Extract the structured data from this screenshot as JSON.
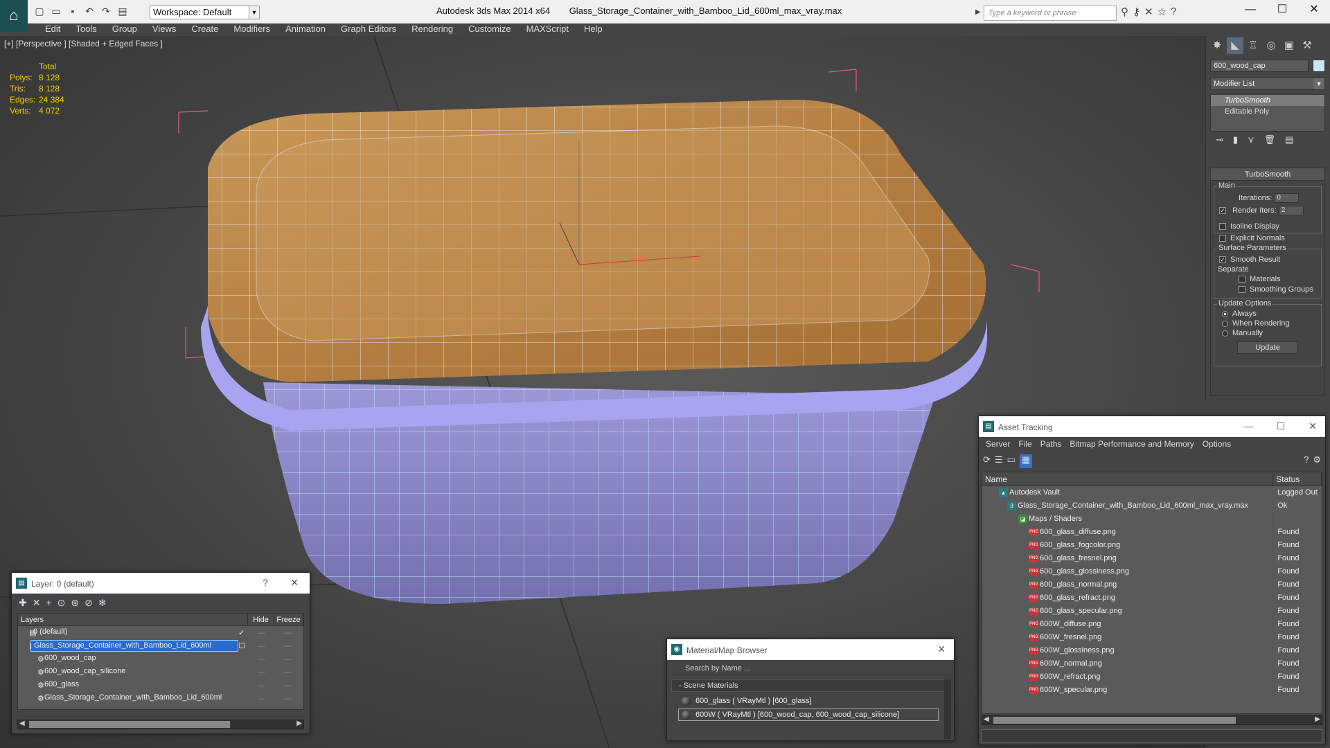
{
  "app": {
    "name": "Autodesk 3ds Max  2014 x64",
    "file": "Glass_Storage_Container_with_Bamboo_Lid_600ml_max_vray.max",
    "workspace": "Workspace: Default",
    "search_placeholder": "Type a keyword or phrase"
  },
  "menu": [
    "Edit",
    "Tools",
    "Group",
    "Views",
    "Create",
    "Modifiers",
    "Animation",
    "Graph Editors",
    "Rendering",
    "Customize",
    "MAXScript",
    "Help"
  ],
  "viewport": {
    "label": "[+] [Perspective ] [Shaded + Edged Faces ]",
    "stats_header": "Total",
    "stats": [
      {
        "k": "Polys:",
        "v": "8 128"
      },
      {
        "k": "Tris:",
        "v": "8 128"
      },
      {
        "k": "Edges:",
        "v": "24 384"
      },
      {
        "k": "Verts:",
        "v": "4 072"
      }
    ]
  },
  "command_panel": {
    "object_name": "600_wood_cap",
    "modifier_list": "Modifier List",
    "stack": [
      "TurboSmooth",
      "Editable Poly"
    ],
    "rollout_title": "TurboSmooth",
    "main_label": "Main",
    "iterations_label": "Iterations:",
    "iterations_value": "0",
    "render_iters_label": "Render Iters:",
    "render_iters_value": "2",
    "isoline": "Isoline Display",
    "explicit_normals": "Explicit Normals",
    "surface_label": "Surface Parameters",
    "smooth_result": "Smooth Result",
    "separate_label": "Separate",
    "materials": "Materials",
    "smoothing_groups": "Smoothing Groups",
    "update_label": "Update Options",
    "always": "Always",
    "when_rendering": "When Rendering",
    "manually": "Manually",
    "update_button": "Update"
  },
  "layers": {
    "title": "Layer: 0 (default)",
    "help": "?",
    "close": "✕",
    "col_layers": "Layers",
    "col_hide": "Hide",
    "col_freeze": "Freeze",
    "rows": [
      {
        "name": "0 (default)"
      },
      {
        "name": "Glass_Storage_Container_with_Bamboo_Lid_600ml"
      },
      {
        "name": "600_wood_cap"
      },
      {
        "name": "600_wood_cap_silicone"
      },
      {
        "name": "600_glass"
      },
      {
        "name": "Glass_Storage_Container_with_Bamboo_Lid_600ml"
      }
    ]
  },
  "material_browser": {
    "title": "Material/Map Browser",
    "search": "Search by Name ...",
    "section": "- Scene Materials",
    "rows": [
      "600_glass  ( VRayMtl )  [600_glass]",
      "600W  ( VRayMtl )  [600_wood_cap, 600_wood_cap_silicone]"
    ]
  },
  "asset_tracking": {
    "title": "Asset Tracking",
    "menu": [
      "Server",
      "File",
      "Paths",
      "Bitmap Performance and Memory",
      "Options"
    ],
    "col_name": "Name",
    "col_status": "Status",
    "rows": [
      {
        "name": "Autodesk Vault",
        "status": "Logged Out"
      },
      {
        "name": "Glass_Storage_Container_with_Bamboo_Lid_600ml_max_vray.max",
        "status": "Ok"
      },
      {
        "name": "Maps / Shaders",
        "status": ""
      },
      {
        "name": "600_glass_diffuse.png",
        "status": "Found"
      },
      {
        "name": "600_glass_fogcolor.png",
        "status": "Found"
      },
      {
        "name": "600_glass_fresnel.png",
        "status": "Found"
      },
      {
        "name": "600_glass_glossiness.png",
        "status": "Found"
      },
      {
        "name": "600_glass_normal.png",
        "status": "Found"
      },
      {
        "name": "600_glass_refract.png",
        "status": "Found"
      },
      {
        "name": "600_glass_specular.png",
        "status": "Found"
      },
      {
        "name": "600W_diffuse.png",
        "status": "Found"
      },
      {
        "name": "600W_fresnel.png",
        "status": "Found"
      },
      {
        "name": "600W_glossiness.png",
        "status": "Found"
      },
      {
        "name": "600W_normal.png",
        "status": "Found"
      },
      {
        "name": "600W_refract.png",
        "status": "Found"
      },
      {
        "name": "600W_specular.png",
        "status": "Found"
      }
    ]
  },
  "colors": {
    "selection": "#2a6ad0",
    "stats": "#f0d000",
    "accent": "#1c6b70"
  }
}
